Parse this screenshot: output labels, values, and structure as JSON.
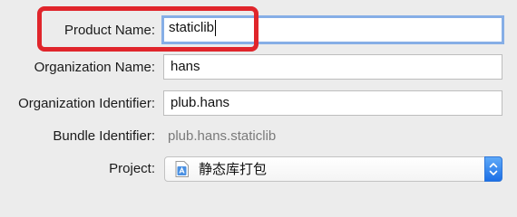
{
  "form": {
    "product_name": {
      "label": "Product Name:",
      "value": "staticlib"
    },
    "organization_name": {
      "label": "Organization Name:",
      "value": "hans"
    },
    "organization_identifier": {
      "label": "Organization Identifier:",
      "value": "plub.hans"
    },
    "bundle_identifier": {
      "label": "Bundle Identifier:",
      "value": "plub.hans.staticlib"
    },
    "project": {
      "label": "Project:",
      "selected": "静态库打包",
      "icon": "xcode-project-icon"
    }
  },
  "colors": {
    "highlight": "#e0252b",
    "focus_ring": "#86aee6",
    "stepper": "#1b6fe6"
  }
}
